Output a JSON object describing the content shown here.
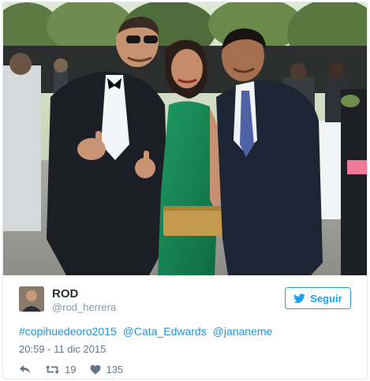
{
  "tweet": {
    "author": {
      "name": "ROD",
      "handle": "@rod_herrera",
      "avatar_icon": "user-avatar"
    },
    "follow_button": {
      "label": "Seguir",
      "icon": "twitter-bird-icon",
      "color": "#1da1f2"
    },
    "text_parts": [
      "#copihuedeoro2015",
      "@Cata_Edwards",
      "@jananeme"
    ],
    "link_color": "#1b95e0",
    "timestamp": "20:59 - 11 dic 2015",
    "actions": {
      "reply_icon": "reply-icon",
      "retweet_icon": "retweet-icon",
      "retweet_count": "19",
      "like_icon": "heart-icon",
      "like_count": "135"
    },
    "photo": {
      "description_icon": "event-photo"
    }
  }
}
